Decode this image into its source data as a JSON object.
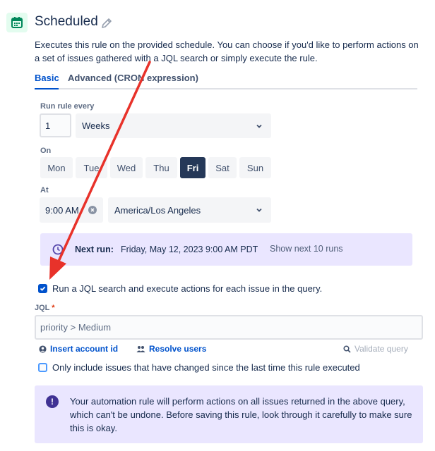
{
  "header": {
    "title": "Scheduled",
    "description": "Executes this rule on the provided schedule. You can choose if you'd like to perform actions on a set of issues gathered with a JQL search or simply execute the rule."
  },
  "tabs": [
    {
      "label": "Basic",
      "active": true
    },
    {
      "label": "Advanced (CRON expression)",
      "active": false
    }
  ],
  "schedule": {
    "run_every_label": "Run rule every",
    "interval_value": "1",
    "interval_unit": "Weeks",
    "on_label": "On",
    "days": [
      "Mon",
      "Tue",
      "Wed",
      "Thu",
      "Fri",
      "Sat",
      "Sun"
    ],
    "selected_day": "Fri",
    "at_label": "At",
    "time_value": "9:00 AM",
    "timezone": "America/Los Angeles"
  },
  "next_run": {
    "label": "Next run:",
    "value": "Friday, May 12, 2023 9:00 AM PDT",
    "link": "Show next 10 runs"
  },
  "jql": {
    "checkbox_label": "Run a JQL search and execute actions for each issue in the query.",
    "checkbox_checked": true,
    "field_label": "JQL",
    "required_marker": "*",
    "value": "priority > Medium",
    "insert_account_id": "Insert account id",
    "resolve_users": "Resolve users",
    "validate_query": "Validate query",
    "only_changed_label": "Only include issues that have changed since the last time this rule executed",
    "only_changed_checked": false
  },
  "warning": {
    "text": "Your automation rule will perform actions on all issues returned in the above query, which can't be undone. Before saving this rule, look through it carefully to make sure this is okay."
  },
  "colors": {
    "accent": "#0052cc",
    "selected_day": "#253858",
    "panel": "#eae6ff",
    "annotation_arrow": "#e8322a",
    "header_icon": "#36b37e"
  }
}
